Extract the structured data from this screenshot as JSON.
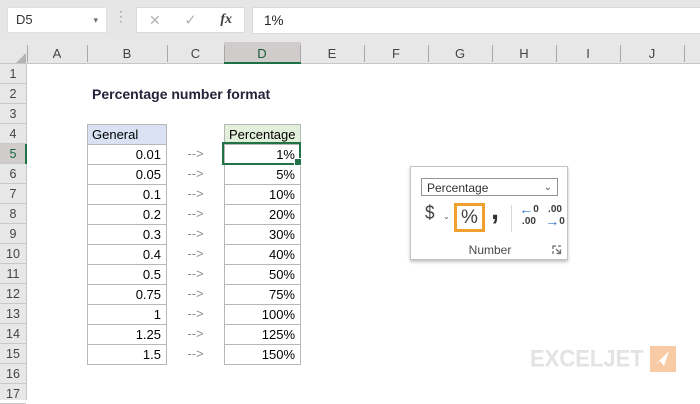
{
  "formula_bar": {
    "name_box_value": "D5",
    "formula_value": "1%",
    "cancel_icon": "✕",
    "enter_icon": "✓",
    "fx_label": "fx",
    "dots": "⋮",
    "dropdown_arrow": "▾"
  },
  "grid": {
    "column_labels": [
      "A",
      "B",
      "C",
      "D",
      "E",
      "F",
      "G",
      "H",
      "I",
      "J"
    ],
    "selected_column": "D",
    "row_labels": [
      "1",
      "2",
      "3",
      "4",
      "5",
      "6",
      "7",
      "8",
      "9",
      "10",
      "11",
      "12",
      "13",
      "14",
      "15",
      "16",
      "17"
    ],
    "selected_row": "5",
    "title": "Percentage number format",
    "table": {
      "left_header": "General",
      "right_header": "Percentage",
      "arrow": "--&gt;",
      "rows": [
        {
          "general": "0.01",
          "percent": "1%"
        },
        {
          "general": "0.05",
          "percent": "5%"
        },
        {
          "general": "0.1",
          "percent": "10%"
        },
        {
          "general": "0.2",
          "percent": "20%"
        },
        {
          "general": "0.3",
          "percent": "30%"
        },
        {
          "general": "0.4",
          "percent": "40%"
        },
        {
          "general": "0.5",
          "percent": "50%"
        },
        {
          "general": "0.75",
          "percent": "75%"
        },
        {
          "general": "1",
          "percent": "100%"
        },
        {
          "general": "1.25",
          "percent": "125%"
        },
        {
          "general": "1.5",
          "percent": "150%"
        }
      ]
    },
    "colors": {
      "excel_green": "#217346",
      "left_header_fill": "#d9e1f2",
      "right_header_fill": "#e2efda"
    }
  },
  "number_panel": {
    "dropdown_value": "Percentage",
    "dollar_label": "$",
    "percent_label": "%",
    "comma_label": ",",
    "increase_decimal_top": "←0",
    "increase_decimal_bottom": ".00",
    "decrease_decimal_top": ".00",
    "decrease_decimal_bottom": "→0",
    "group_label": "Number",
    "highlight_color": "#f0a02e"
  },
  "logo": {
    "text": "EXCELJET",
    "accent_color": "#f8cba4"
  }
}
